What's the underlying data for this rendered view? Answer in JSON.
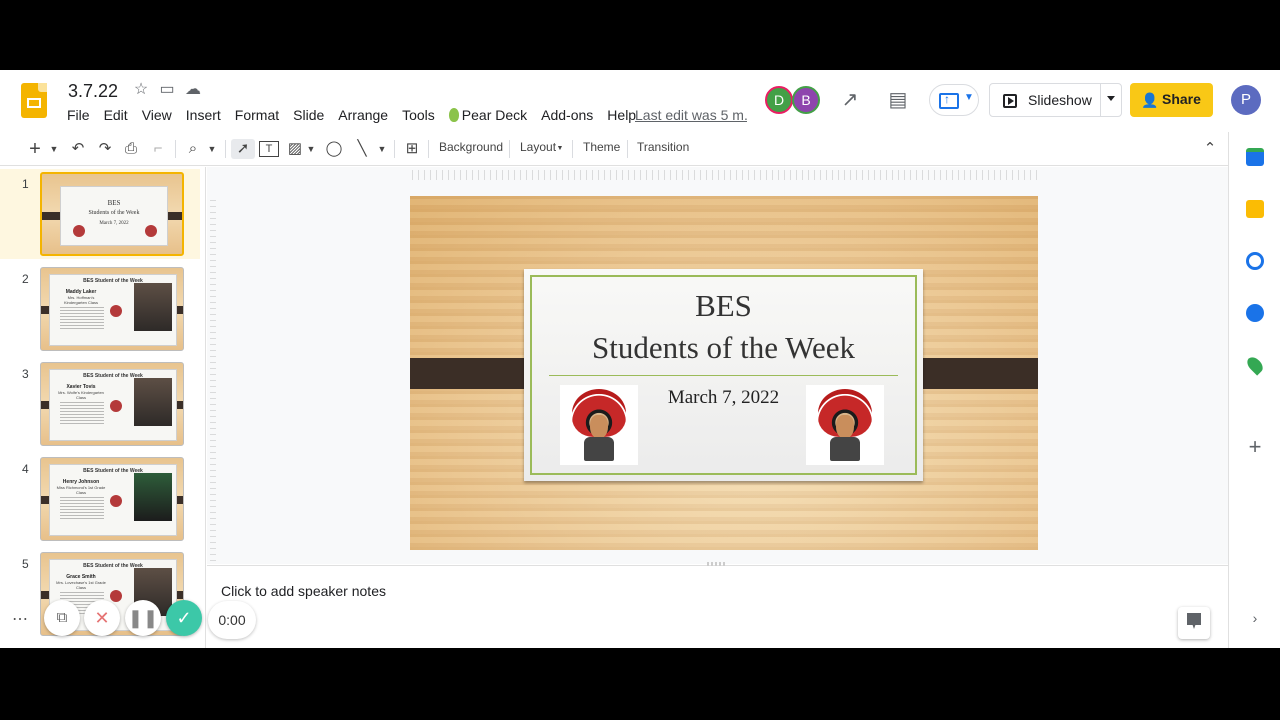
{
  "doc": {
    "title": "3.7.22"
  },
  "menu": {
    "items": [
      "File",
      "Edit",
      "View",
      "Insert",
      "Format",
      "Slide",
      "Arrange",
      "Tools",
      "Pear Deck",
      "Add-ons",
      "Help"
    ],
    "last_edit": "Last edit was 5 m..."
  },
  "collaborators": [
    "D",
    "B"
  ],
  "header": {
    "slideshow_label": "Slideshow",
    "share_label": "Share",
    "account_initial": "P"
  },
  "toolbar": {
    "background_label": "Background",
    "layout_label": "Layout",
    "theme_label": "Theme",
    "transition_label": "Transition"
  },
  "filmstrip": {
    "slides": [
      {
        "num": "1",
        "selected": true,
        "title": "BES",
        "subtitle": "Students of the Week",
        "date": "March 7, 2022"
      },
      {
        "num": "2",
        "heading": "BES Student of the Week",
        "name": "Maddy Laker",
        "sub": "Mrs. Hoffman's Kindergarten Class"
      },
      {
        "num": "3",
        "heading": "BES Student of the Week",
        "name": "Xavier Tovis",
        "sub": "Mrs. Wolfe's Kindergarten Class"
      },
      {
        "num": "4",
        "heading": "BES Student of the Week",
        "name": "Henry Johnson",
        "sub": "Miss Richmond's 1st Grade Class"
      },
      {
        "num": "5",
        "heading": "BES Student of the Week",
        "name": "Grace Smith",
        "sub": "Mrs. Lovechase's 1st Grade Class"
      }
    ]
  },
  "slide": {
    "title_line1": "BES",
    "title_line2": "Students of the Week",
    "date": "March 7, 2022"
  },
  "notes": {
    "placeholder": "Click to add speaker notes"
  },
  "recorder": {
    "time": "0:00"
  },
  "colors": {
    "accent": "#f4b400",
    "share": "#f9c816",
    "border_green": "#9bbb59",
    "band": "#3b2e26"
  }
}
